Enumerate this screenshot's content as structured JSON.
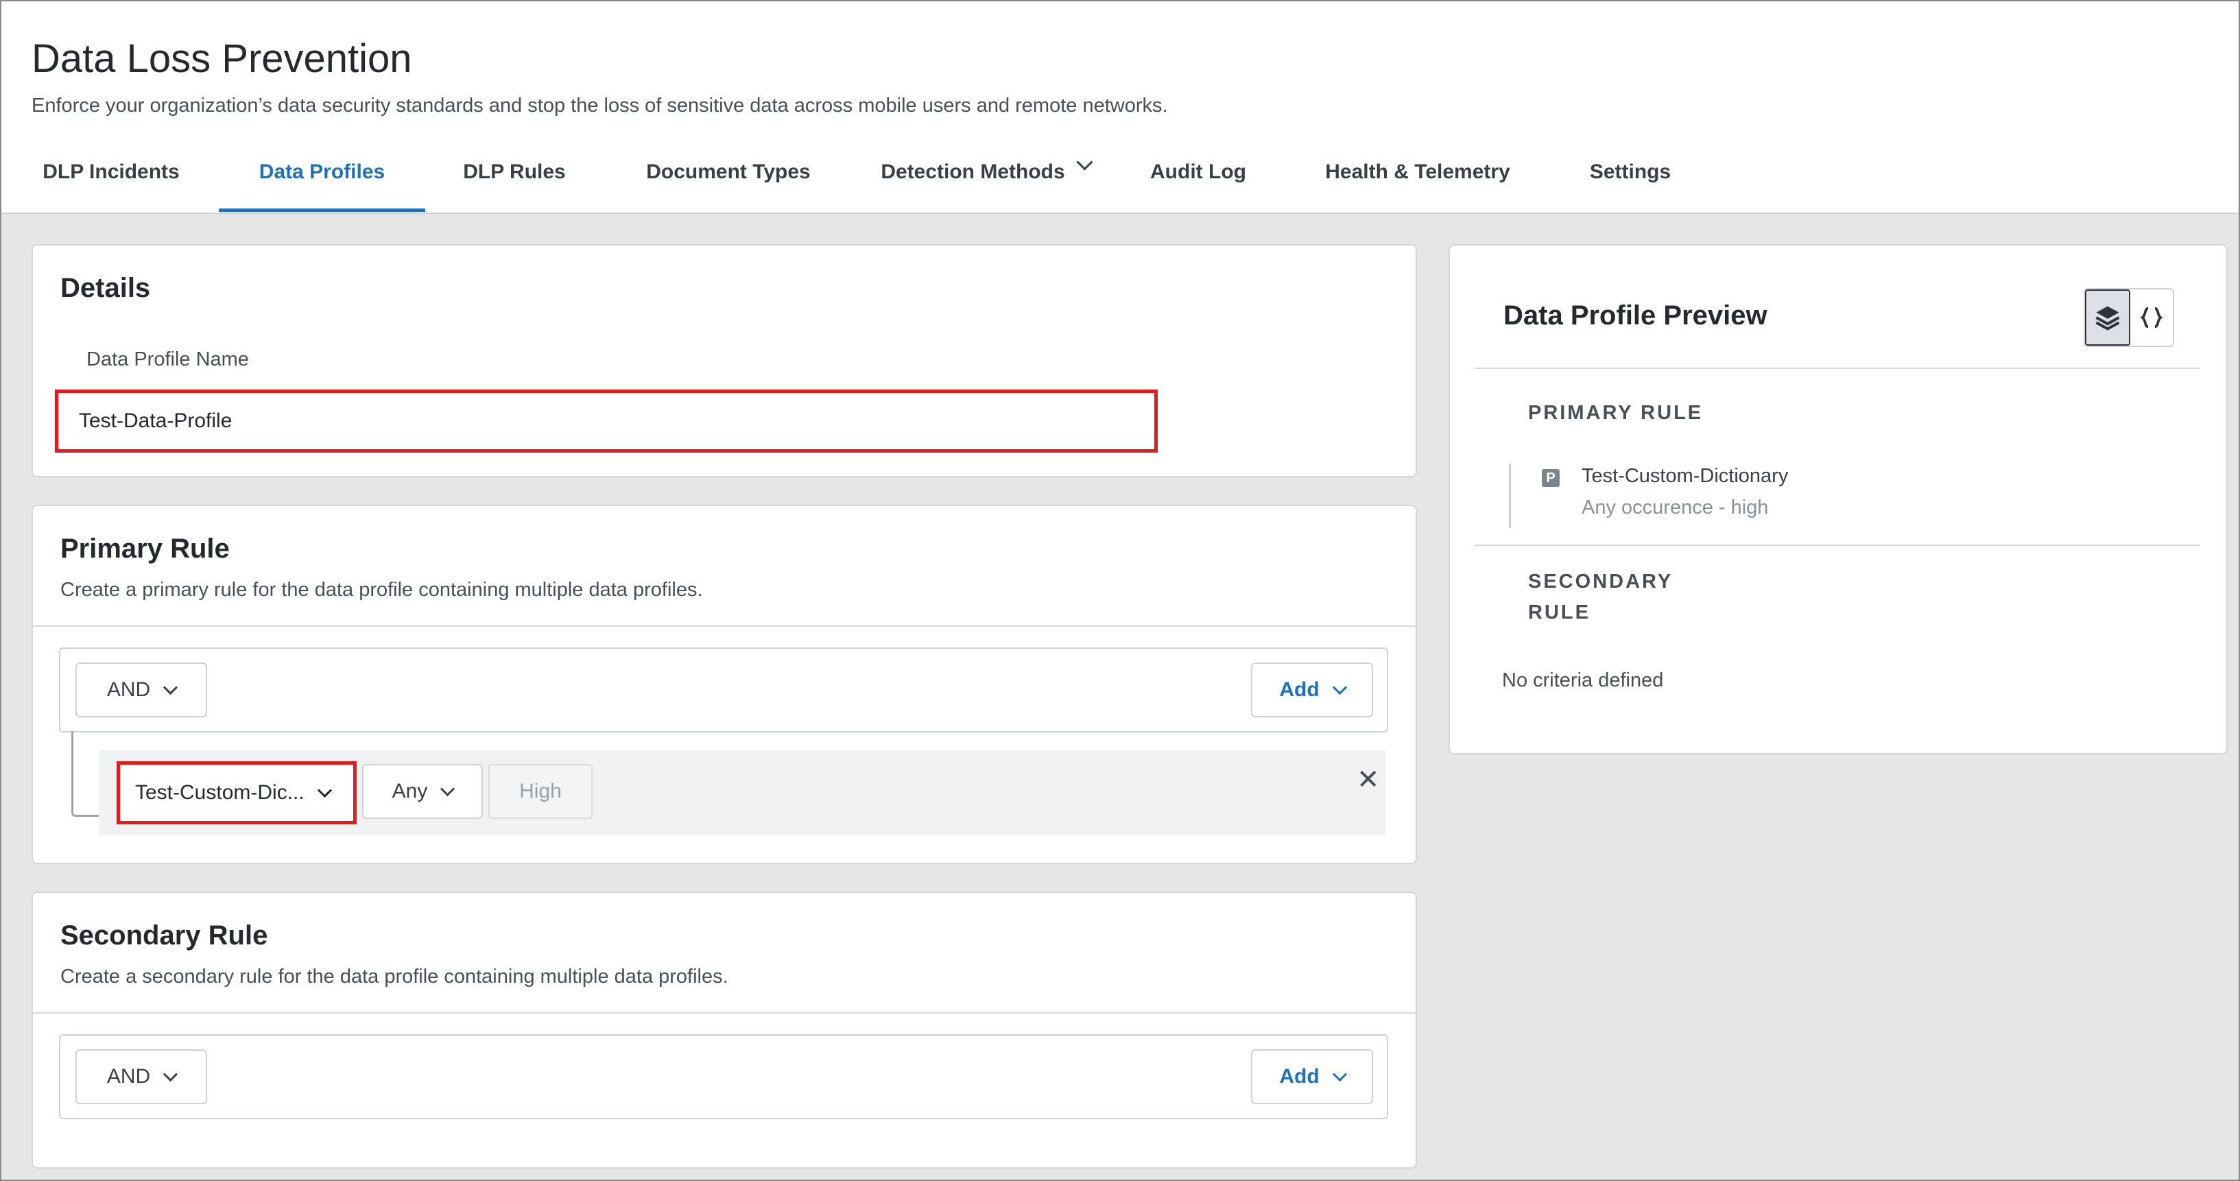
{
  "header": {
    "title": "Data Loss Prevention",
    "subtitle": "Enforce your organization’s data security standards and stop the loss of sensitive data across mobile users and remote networks."
  },
  "tabs": [
    {
      "label": "DLP Incidents",
      "active": false
    },
    {
      "label": "Data Profiles",
      "active": true
    },
    {
      "label": "DLP Rules",
      "active": false
    },
    {
      "label": "Document Types",
      "active": false
    },
    {
      "label": "Detection Methods",
      "active": false,
      "has_dropdown": true
    },
    {
      "label": "Audit Log",
      "active": false
    },
    {
      "label": "Health & Telemetry",
      "active": false
    },
    {
      "label": "Settings",
      "active": false
    }
  ],
  "details": {
    "title": "Details",
    "name_label": "Data Profile Name",
    "name_value": "Test-Data-Profile"
  },
  "primary_rule": {
    "title": "Primary Rule",
    "description": "Create a primary rule for the data profile containing multiple data profiles.",
    "operator": "AND",
    "add_label": "Add",
    "condition": {
      "dictionary": "Test-Custom-Dic...",
      "occurrence": "Any",
      "confidence": "High",
      "remove_glyph": "✕"
    }
  },
  "secondary_rule": {
    "title": "Secondary Rule",
    "description": "Create a secondary rule for the data profile containing multiple data profiles.",
    "operator": "AND",
    "add_label": "Add"
  },
  "preview": {
    "title": "Data Profile Preview",
    "primary_label": "PRIMARY RULE",
    "primary_item_badge": "P",
    "primary_item_name": "Test-Custom-Dictionary",
    "primary_item_detail": "Any occurence - high",
    "secondary_label_line1": "SECONDARY",
    "secondary_label_line2": "RULE",
    "secondary_empty": "No criteria defined",
    "toggle_icons": [
      "layers-icon",
      "json-braces-icon"
    ]
  },
  "colors": {
    "accent": "#1d6fc2",
    "highlight": "#e21b1b",
    "background": "#e6e6e6"
  }
}
